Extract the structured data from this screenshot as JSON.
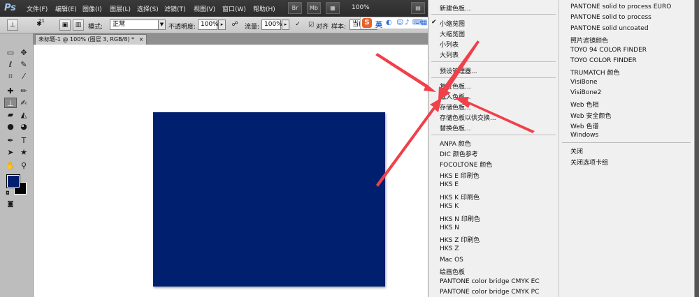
{
  "app": {
    "logo": "Ps"
  },
  "menubar": {
    "items": [
      "文件(F)",
      "编辑(E)",
      "图像(I)",
      "图层(L)",
      "选择(S)",
      "滤镜(T)",
      "视图(V)",
      "窗口(W)",
      "帮助(H)"
    ],
    "buttons": [
      "Br",
      "Mb"
    ],
    "zoom": "100%"
  },
  "ime": {
    "logo": "S",
    "lang": "英"
  },
  "options": {
    "brush_size": "21",
    "mode_label": "模式:",
    "mode_value": "正常",
    "opacity_label": "不透明度:",
    "opacity_value": "100%",
    "flow_label": "流量:",
    "flow_value": "100%",
    "align_label": "对齐",
    "sample_label": "样本:",
    "sample_value": "当前"
  },
  "document": {
    "tab_title": "未标题-1 @ 100% (图层 3, RGB/8) *",
    "close": "×"
  },
  "colors": {
    "foreground": "#011f6f",
    "background": "#000000",
    "canvas_rect": "#011f6f",
    "arrow": "#f0404a"
  },
  "panel_menu": {
    "group1": [
      "新建色板..."
    ],
    "group2": [
      "小缩览图",
      "大缩览图",
      "小列表",
      "大列表"
    ],
    "checked": "小缩览图",
    "group3": [
      "预设管理器..."
    ],
    "group4": [
      "复位色板...",
      "载入色板...",
      "存储色板...",
      "存储色板以供交换...",
      "替换色板..."
    ],
    "group5": [
      "ANPA 颜色",
      "DIC 颜色参考",
      "FOCOLTONE 颜色",
      "HKS E 印刷色",
      "HKS E",
      "HKS K 印刷色",
      "HKS K",
      "HKS N 印刷色",
      "HKS N",
      "HKS Z 印刷色",
      "HKS Z",
      "Mac OS",
      "绘画色板",
      "PANTONE color bridge CMYK EC",
      "PANTONE color bridge CMYK PC"
    ]
  },
  "sub_menu": {
    "group1": [
      "PANTONE solid to process EURO",
      "PANTONE solid to process",
      "PANTONE solid uncoated",
      "照片滤镜颜色",
      "TOYO 94 COLOR FINDER",
      "TOYO COLOR FINDER",
      "TRUMATCH 颜色",
      "VisiBone",
      "VisiBone2",
      "Web 色相",
      "Web 安全颜色",
      "Web 色谱",
      "Windows"
    ],
    "group2": [
      "关闭",
      "关闭选项卡组"
    ]
  }
}
